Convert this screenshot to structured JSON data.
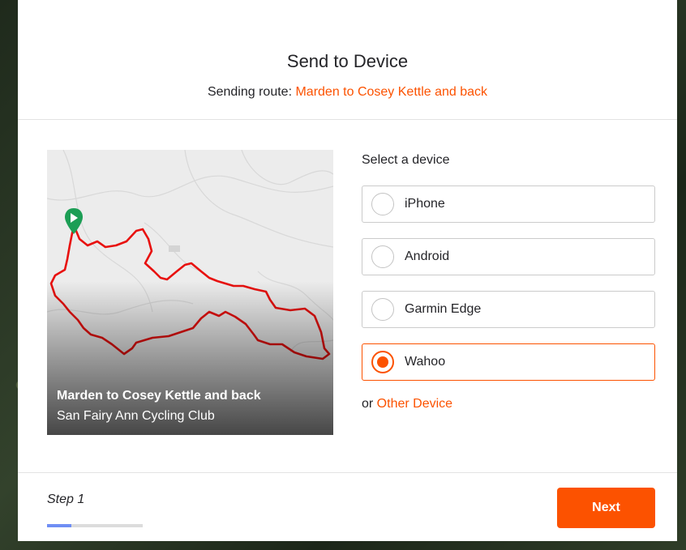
{
  "modal": {
    "title": "Send to Device",
    "subtitle_prefix": "Sending route: ",
    "route_link": "Marden to Cosey Kettle and back"
  },
  "map": {
    "route_name": "Marden to Cosey Kettle and back",
    "club_name": "San Fairy Ann Cycling Club",
    "start_icon": "play-marker-icon",
    "route_color": "#e8110f"
  },
  "devices": {
    "label": "Select a device",
    "options": [
      {
        "label": "iPhone",
        "selected": false
      },
      {
        "label": "Android",
        "selected": false
      },
      {
        "label": "Garmin Edge",
        "selected": false
      },
      {
        "label": "Wahoo",
        "selected": true
      }
    ],
    "other_prefix": "or ",
    "other_link": "Other Device"
  },
  "footer": {
    "step_label": "Step 1",
    "progress": 0.25,
    "next_label": "Next"
  },
  "colors": {
    "accent": "#fc5200",
    "progress": "#6f8ef4"
  }
}
